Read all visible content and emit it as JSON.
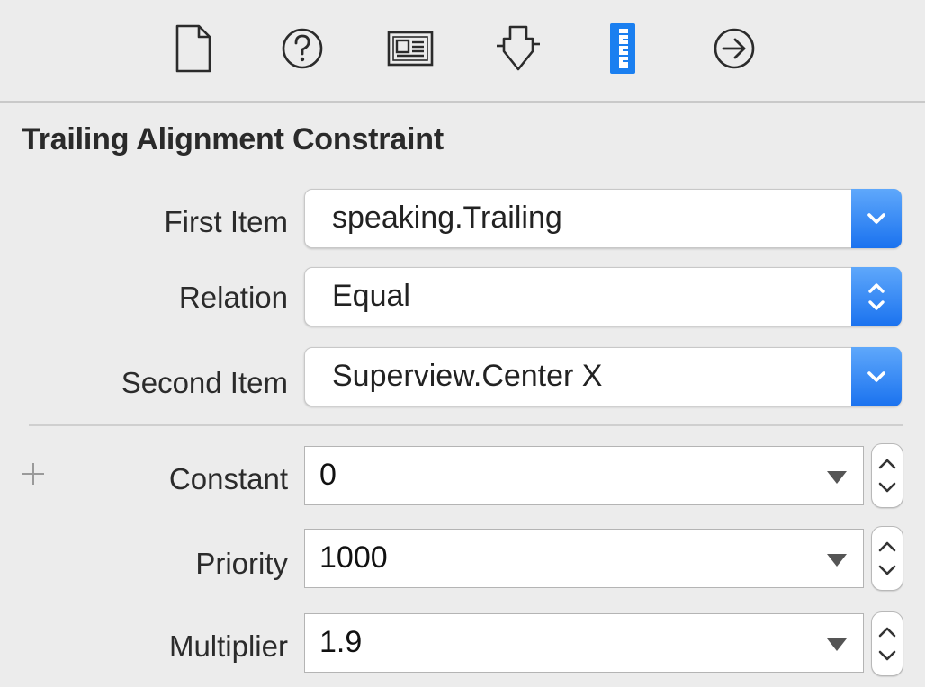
{
  "toolbar": {
    "tabs": [
      {
        "icon": "file-icon",
        "active": false
      },
      {
        "icon": "help-icon",
        "active": false
      },
      {
        "icon": "identity-icon",
        "active": false
      },
      {
        "icon": "attributes-icon",
        "active": false
      },
      {
        "icon": "size-ruler-icon",
        "active": true
      },
      {
        "icon": "connections-arrow-icon",
        "active": false
      }
    ],
    "accent_color": "#1a7ff0"
  },
  "section": {
    "title": "Trailing Alignment Constraint"
  },
  "fields": {
    "first_item": {
      "label": "First Item",
      "value": "speaking.Trailing"
    },
    "relation": {
      "label": "Relation",
      "value": "Equal"
    },
    "second_item": {
      "label": "Second Item",
      "value": "Superview.Center X"
    },
    "constant": {
      "label": "Constant",
      "value": "0"
    },
    "priority": {
      "label": "Priority",
      "value": "1000"
    },
    "multiplier": {
      "label": "Multiplier",
      "value": "1.9"
    }
  }
}
